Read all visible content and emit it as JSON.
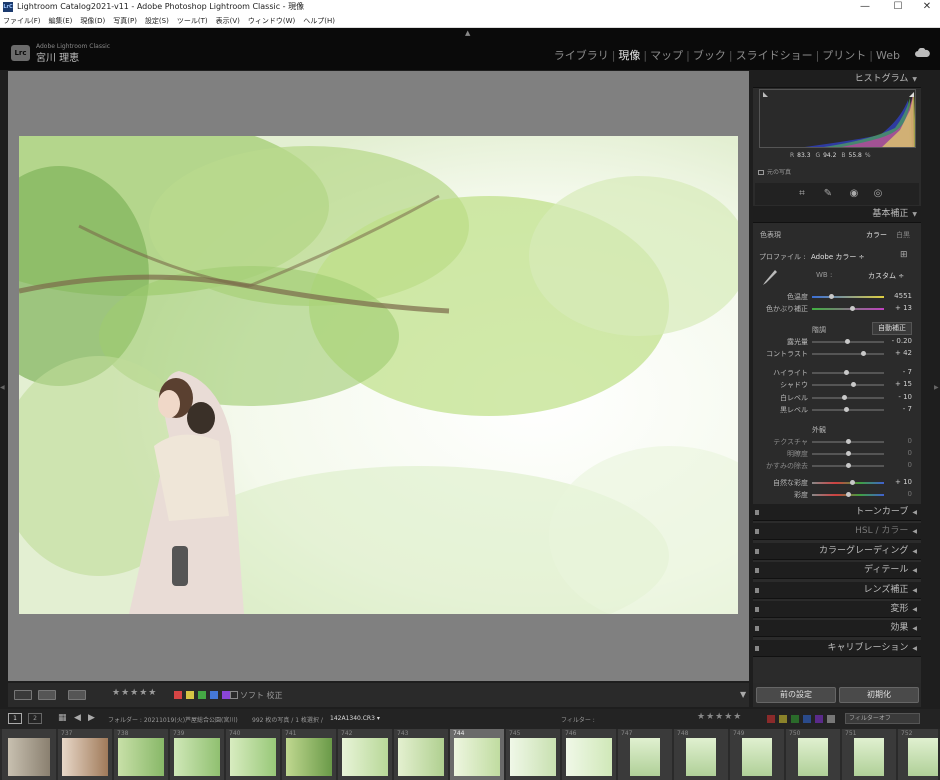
{
  "window": {
    "title": "Lightroom Catalog2021-v11 - Adobe Photoshop Lightroom Classic - 現像",
    "app_icon": "LrC",
    "controls": [
      "—",
      "☐",
      "✕"
    ]
  },
  "menu": [
    "ファイル(F)",
    "編集(E)",
    "現像(D)",
    "写真(P)",
    "設定(S)",
    "ツール(T)",
    "表示(V)",
    "ウィンドウ(W)",
    "ヘルプ(H)"
  ],
  "identity": {
    "logo": "Lrc",
    "product": "Adobe Lightroom Classic",
    "user": "宮川 理恵"
  },
  "modules": [
    "ライブラリ",
    "現像",
    "マップ",
    "ブック",
    "スライドショー",
    "プリント",
    "Web"
  ],
  "active_module": "現像",
  "histogram": {
    "title": "ヒストグラム",
    "r_label": "R",
    "r_value": "83.3",
    "g_label": "G",
    "g_value": "94.2",
    "b_label": "B",
    "b_value": "55.8",
    "unit": "%",
    "original_label": "元の写真"
  },
  "basic": {
    "title": "基本補正",
    "treatment_label": "色表現",
    "color_label": "カラー",
    "bw_label": "白黒",
    "profile_label": "プロファイル :",
    "profile_value": "Adobe カラー ÷",
    "wb_label": "WB :",
    "wb_value": "カスタム ÷",
    "temp_label": "色温度",
    "temp_value": "4551",
    "temp_pos": 0.27,
    "tint_label": "色かぶり補正",
    "tint_value": "+ 13",
    "tint_pos": 0.55,
    "tone_label": "階調",
    "auto_label": "自動補正",
    "exposure_label": "露光量",
    "exposure_value": "- 0.20",
    "exposure_pos": 0.48,
    "contrast_label": "コントラスト",
    "contrast_value": "+ 42",
    "contrast_pos": 0.71,
    "highlights_label": "ハイライト",
    "highlights_value": "- 7",
    "highlights_pos": 0.47,
    "shadows_label": "シャドウ",
    "shadows_value": "+ 15",
    "shadows_pos": 0.57,
    "whites_label": "白レベル",
    "whites_value": "- 10",
    "whites_pos": 0.45,
    "blacks_label": "黒レベル",
    "blacks_value": "- 7",
    "blacks_pos": 0.47,
    "presence_label": "外観",
    "texture_label": "テクスチャ",
    "texture_value": "0",
    "texture_pos": 0.5,
    "clarity_label": "明瞭度",
    "clarity_value": "0",
    "clarity_pos": 0.5,
    "dehaze_label": "かすみの除去",
    "dehaze_value": "0",
    "dehaze_pos": 0.5,
    "vibrance_label": "自然な彩度",
    "vibrance_value": "+ 10",
    "vibrance_pos": 0.55,
    "saturation_label": "彩度",
    "saturation_value": "0",
    "saturation_pos": 0.5
  },
  "panels": [
    "トーンカーブ",
    "HSL / カラー",
    "カラーグレーディング",
    "ディテール",
    "レンズ補正",
    "変形",
    "効果",
    "キャリブレーション"
  ],
  "footer": {
    "previous": "前の設定",
    "reset": "初期化"
  },
  "toolbar": {
    "stars": "★★★★★",
    "soft_proof": "ソフト 校正",
    "label_colors": [
      "#d64545",
      "#d6c545",
      "#45a845",
      "#4578d6",
      "#8a45d6"
    ]
  },
  "filmstrip": {
    "view1": "1",
    "view2": "2",
    "folder": "フォルダー : 20211019(火)芦屋総合公園(宮川)",
    "count": "992 枚の写真 / 1 枚選択 /",
    "file": "142A1340.CR3 ▾",
    "filter_label": "フィルター :",
    "filter_stars": "★★★★★",
    "filter_off": "フィルターオフ",
    "numbers": [
      "",
      "737",
      "738",
      "739",
      "740",
      "741",
      "742",
      "743",
      "744",
      "745",
      "746",
      "747",
      "748",
      "749",
      "750",
      "751",
      "752"
    ]
  }
}
